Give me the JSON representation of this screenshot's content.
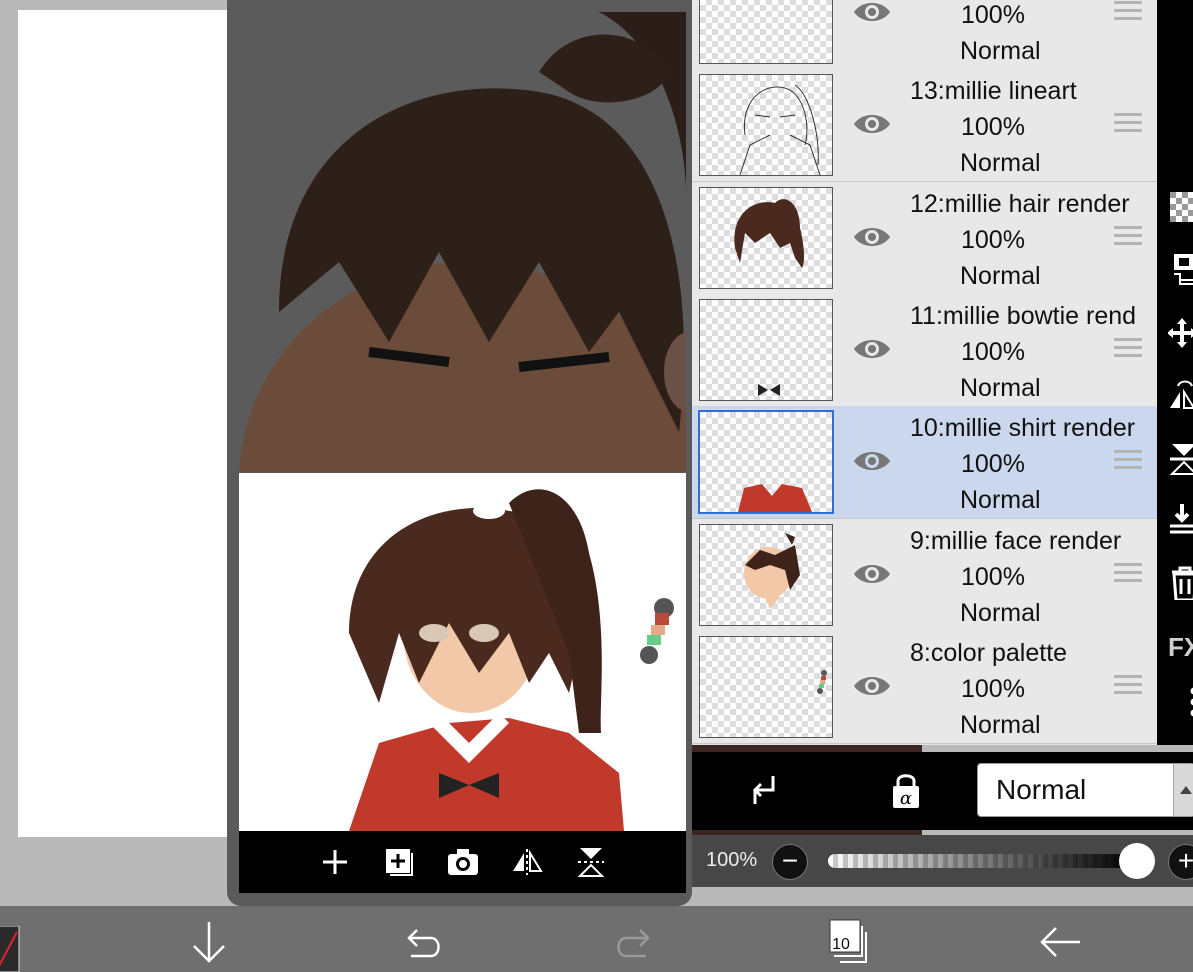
{
  "layers": [
    {
      "name": "",
      "opacity": "100%",
      "blend": "Normal"
    },
    {
      "name": "13:millie lineart",
      "opacity": "100%",
      "blend": "Normal"
    },
    {
      "name": "12:millie hair render",
      "opacity": "100%",
      "blend": "Normal"
    },
    {
      "name": "11:millie bowtie rend",
      "opacity": "100%",
      "blend": "Normal"
    },
    {
      "name": "10:millie shirt render",
      "opacity": "100%",
      "blend": "Normal",
      "selected": true
    },
    {
      "name": "9:millie face render",
      "opacity": "100%",
      "blend": "Normal"
    },
    {
      "name": "8:color palette",
      "opacity": "100%",
      "blend": "Normal"
    }
  ],
  "layer_actions": {
    "clip_icon": "clipping-arrow-icon",
    "alpha_lock_icon": "alpha-lock-icon",
    "blend_mode": "Normal"
  },
  "opacity": {
    "label": "100%",
    "minus": "−",
    "plus": "+",
    "value_fraction": 1.0
  },
  "side_tools": {
    "fx_label": "FX"
  },
  "nav_toolbar_icons": [
    "add-icon",
    "add-layer-icon",
    "camera-icon",
    "flip-horizontal-icon",
    "flip-vertical-icon"
  ],
  "bottom_bar": {
    "layers_count": "10"
  },
  "colors": {
    "selection_border": "#2f6fd6",
    "selected_row_bg": "#cbd7ec",
    "shirt_red": "#c0392b",
    "hair_brown": "#4a2a1f"
  }
}
